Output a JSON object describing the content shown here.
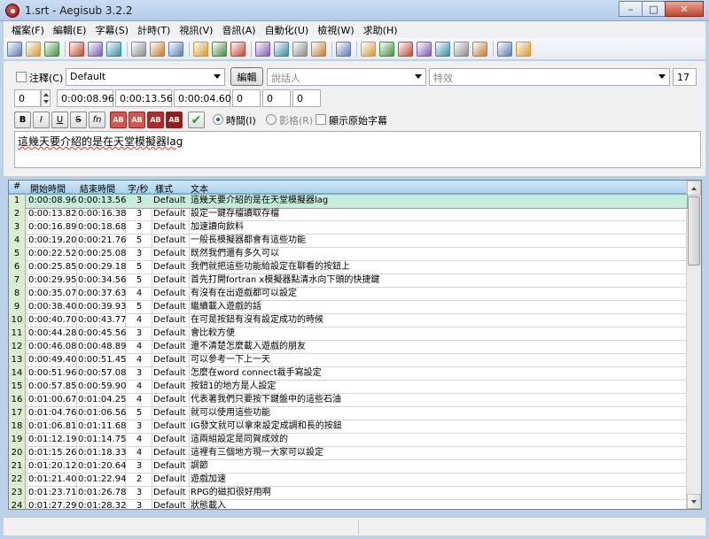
{
  "window": {
    "title": "1.srt - Aegisub 3.2.2",
    "minimize_glyph": "–",
    "maximize_glyph": "□",
    "close_glyph": "✕"
  },
  "menu": [
    "檔案(F)",
    "編輯(E)",
    "字幕(S)",
    "計時(T)",
    "視訊(V)",
    "音訊(A)",
    "自動化(U)",
    "檢視(W)",
    "求助(H)"
  ],
  "toolbar_icons": [
    "new-file-icon",
    "open-file-icon",
    "save-icon",
    "sep",
    "jump-to-icon",
    "zoom-in-icon",
    "zoom-out-icon",
    "sep",
    "video-keyframe-icon",
    "video-jump-icon",
    "video-details-icon",
    "sep",
    "styles-icon",
    "style-manager-icon",
    "attachments-icon",
    "sep",
    "shift-times-icon",
    "translation-icon",
    "find-icon",
    "replace-icon",
    "sep",
    "automation-icon",
    "sep",
    "snap-to-scene-icon",
    "timing-post-icon",
    "resample-icon",
    "stop-icon",
    "clock-icon",
    "spellcheck-icon",
    "font-collector-icon",
    "sep",
    "options-icon",
    "hotkeys-icon"
  ],
  "edit": {
    "comment_label": "注釋(C)",
    "style_value": "Default",
    "edit_button": "編輯",
    "actor_placeholder": "說話人",
    "effect_placeholder": "特效",
    "layer_value": "17",
    "margin_layer": "0",
    "start_time": "0:00:08.96",
    "end_time": "0:00:13.56",
    "duration": "0:00:04.60",
    "margin_l": "0",
    "margin_r": "0",
    "margin_v": "0",
    "fmt_bold": "B",
    "fmt_italic": "I",
    "fmt_underline": "U",
    "fmt_strike": "S",
    "fmt_font": "fn",
    "color_labels": [
      "AB",
      "AB",
      "AB",
      "AB"
    ],
    "commit_glyph": "✔",
    "radio_time": "時間(I)",
    "radio_frame": "影格(R)",
    "show_original_label": "顯示原始字幕",
    "text": "這幾天要介紹的是在天堂模擬器lag"
  },
  "grid": {
    "headers": [
      "#",
      "開始時間",
      "結束時間",
      "字/秒",
      "樣式",
      "文本"
    ],
    "rows": [
      [
        "1",
        "0:00:08.96",
        "0:00:13.56",
        "3",
        "Default",
        "這幾天要介紹的是在天堂模擬器lag"
      ],
      [
        "2",
        "0:00:13.82",
        "0:00:16.38",
        "3",
        "Default",
        "設定一鍵存檔讀取存檔"
      ],
      [
        "3",
        "0:00:16.89",
        "0:00:18.68",
        "3",
        "Default",
        "加速讀向飲料"
      ],
      [
        "4",
        "0:00:19.20",
        "0:00:21.76",
        "5",
        "Default",
        "一般長模擬器都會有這些功能"
      ],
      [
        "5",
        "0:00:22.52",
        "0:00:25.08",
        "3",
        "Default",
        "既然我們還有多久可以"
      ],
      [
        "6",
        "0:00:25.85",
        "0:00:29.18",
        "5",
        "Default",
        "我們就把這些功能給設定在聊看的按鈕上"
      ],
      [
        "7",
        "0:00:29.95",
        "0:00:34.56",
        "5",
        "Default",
        "首先打開fortran x模擬器點清水向下頭的快捷鍵"
      ],
      [
        "8",
        "0:00:35.07",
        "0:00:37.63",
        "4",
        "Default",
        "有沒有在出遊戲都可以設定"
      ],
      [
        "9",
        "0:00:38.40",
        "0:00:39.93",
        "5",
        "Default",
        "繼續載入遊戲的話"
      ],
      [
        "10",
        "0:00:40.70",
        "0:00:43.77",
        "4",
        "Default",
        "在可是按鈕有沒有設定成功的時候"
      ],
      [
        "11",
        "0:00:44.28",
        "0:00:45.56",
        "3",
        "Default",
        "會比較方便"
      ],
      [
        "12",
        "0:00:46.08",
        "0:00:48.89",
        "4",
        "Default",
        "還不清楚怎麼載入遊戲的朋友"
      ],
      [
        "13",
        "0:00:49.40",
        "0:00:51.45",
        "4",
        "Default",
        "可以參考一下上一天"
      ],
      [
        "14",
        "0:00:51.96",
        "0:00:57.08",
        "3",
        "Default",
        "怎麼在word connect裁手寫設定"
      ],
      [
        "15",
        "0:00:57.85",
        "0:00:59.90",
        "4",
        "Default",
        "按鈕1的地方是人設定"
      ],
      [
        "16",
        "0:01:00.67",
        "0:01:04.25",
        "4",
        "Default",
        "代表著我們只要按下鍵盤中的這些石油"
      ],
      [
        "17",
        "0:01:04.76",
        "0:01:06.56",
        "5",
        "Default",
        "就可以使用這些功能"
      ],
      [
        "18",
        "0:01:06.81",
        "0:01:11.68",
        "3",
        "Default",
        "IG發文就可以拿來設定成調和長的按鈕"
      ],
      [
        "19",
        "0:01:12.19",
        "0:01:14.75",
        "4",
        "Default",
        "這兩組設定是同賀成效的"
      ],
      [
        "20",
        "0:01:15.26",
        "0:01:18.33",
        "4",
        "Default",
        "這裡有三個地方現一大家可以設定"
      ],
      [
        "21",
        "0:01:20.12",
        "0:01:20.64",
        "3",
        "Default",
        "調節"
      ],
      [
        "22",
        "0:01:21.40",
        "0:01:22.94",
        "2",
        "Default",
        "遊戲加速"
      ],
      [
        "23",
        "0:01:23.71",
        "0:01:26.78",
        "3",
        "Default",
        "RPG的磁扣很好用啊"
      ],
      [
        "24",
        "0:01:27.29",
        "0:01:28.32",
        "3",
        "Default",
        "狀態載入"
      ]
    ]
  },
  "colors": {
    "title_bar": "#c3d7f0",
    "selected_row": "#c6eddb",
    "row_number_bg": "#d9eecf",
    "header_bg": "#bfe0f4"
  }
}
